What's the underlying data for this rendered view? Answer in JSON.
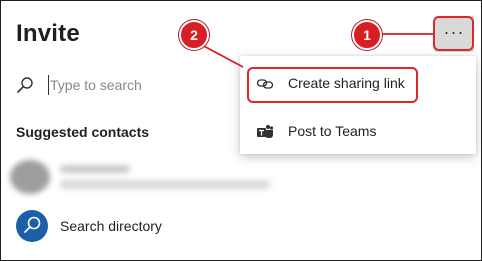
{
  "header": {
    "title": "Invite"
  },
  "more_button": {
    "label": "···"
  },
  "search": {
    "placeholder": "Type to search"
  },
  "suggested": {
    "label": "Suggested contacts"
  },
  "directory": {
    "label": "Search directory"
  },
  "menu": {
    "items": [
      {
        "label": "Create sharing link",
        "icon": "link-icon"
      },
      {
        "label": "Post to Teams",
        "icon": "teams-icon"
      }
    ]
  },
  "callouts": {
    "step1": "1",
    "step2": "2"
  },
  "colors": {
    "callout": "#d81e25",
    "highlight": "#e0262b",
    "directory": "#1b5fa8"
  }
}
